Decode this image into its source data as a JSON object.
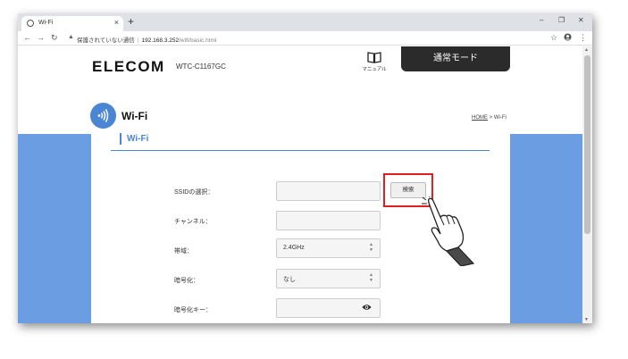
{
  "browser": {
    "tab_title": "Wi-Fi",
    "tab_close": "×",
    "new_tab": "+",
    "window_controls": {
      "minimize": "–",
      "restore": "❐",
      "close": "✕"
    },
    "security_warning": "保護されていない通信",
    "url_host": "192.168.3.252",
    "url_path": "/wifi/basic.html",
    "separator": "|"
  },
  "header": {
    "logo": "ELECOM",
    "model": "WTC-C1167GC",
    "manual_label": "マニュアル",
    "mode_button": "通常モード"
  },
  "page": {
    "title": "Wi-Fi",
    "breadcrumb_home": "HOME",
    "breadcrumb_sep": " > ",
    "breadcrumb_current": "Wi-Fi",
    "section_title": "Wi-Fi"
  },
  "form": {
    "ssid_label": "SSIDの選択：",
    "ssid_value": "",
    "search_button": "検索",
    "channel_label": "チャンネル：",
    "channel_value": "",
    "band_label": "帯域：",
    "band_value": "2.4GHz",
    "encryption_label": "暗号化：",
    "encryption_value": "なし",
    "key_label": "暗号化キー：",
    "key_value": ""
  },
  "colors": {
    "accent": "#4a86d4",
    "side_panels": "#6b9de3",
    "highlight": "#e02020",
    "mode_button_bg": "#2b2b2b"
  }
}
